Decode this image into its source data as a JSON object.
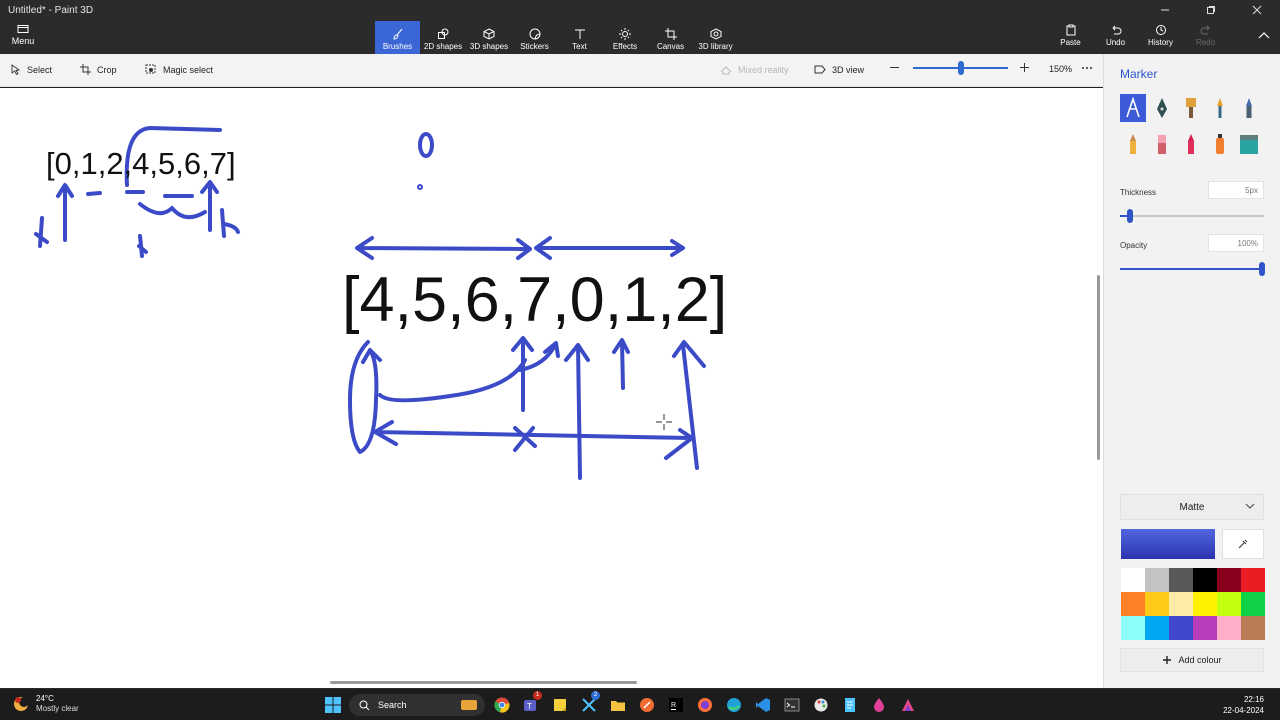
{
  "window": {
    "title": "Untitled* - Paint 3D",
    "controls": [
      "minimize",
      "maximize",
      "close"
    ]
  },
  "ribbon": {
    "menu_label": "Menu",
    "tools": [
      {
        "label": "Brushes",
        "icon": "brush-icon",
        "active": true
      },
      {
        "label": "2D shapes",
        "icon": "2d-shapes-icon",
        "active": false
      },
      {
        "label": "3D shapes",
        "icon": "3d-shapes-icon",
        "active": false
      },
      {
        "label": "Stickers",
        "icon": "stickers-icon",
        "active": false
      },
      {
        "label": "Text",
        "icon": "text-icon",
        "active": false
      },
      {
        "label": "Effects",
        "icon": "effects-icon",
        "active": false
      },
      {
        "label": "Canvas",
        "icon": "canvas-icon",
        "active": false
      },
      {
        "label": "3D library",
        "icon": "3d-library-icon",
        "active": false
      }
    ],
    "actions": [
      {
        "label": "Paste",
        "icon": "paste-icon",
        "enabled": true
      },
      {
        "label": "Undo",
        "icon": "undo-icon",
        "enabled": true
      },
      {
        "label": "History",
        "icon": "history-icon",
        "enabled": true
      },
      {
        "label": "Redo",
        "icon": "redo-icon",
        "enabled": false
      }
    ]
  },
  "subbar": {
    "select_label": "Select",
    "crop_label": "Crop",
    "magic_select_label": "Magic select",
    "mixed_reality_label": "Mixed reality",
    "view_3d_label": "3D view",
    "zoom_value": "150%",
    "zoom_fraction": 0.48
  },
  "canvas": {
    "small_array_text": "[0,1,2,4,5,6,7]",
    "big_array_text": "[4,5,6,7,0,1,2]",
    "ink_color": "#3b4bc8"
  },
  "panel": {
    "title": "Marker",
    "brushes": [
      "marker-icon",
      "calligraphy-pen-icon",
      "oil-brush-icon",
      "watercolor-icon",
      "pixel-pen-icon",
      "pencil-icon",
      "eraser-icon",
      "crayon-icon",
      "spray-can-icon",
      "fill-icon"
    ],
    "thickness_label": "Thickness",
    "thickness_value": "5px",
    "thickness_fraction": 0.05,
    "opacity_label": "Opacity",
    "opacity_value": "100%",
    "opacity_fraction": 1.0,
    "finish_value": "Matte",
    "selected_color": "#3b4bc8",
    "swatches": [
      "#ffffff",
      "#c3c3c3",
      "#585858",
      "#000000",
      "#88001b",
      "#ec1c24",
      "#ff7f27",
      "#ffca18",
      "#fdeca6",
      "#fff200",
      "#c4ff0e",
      "#0ed145",
      "#8cfffb",
      "#00a8f3",
      "#3f48cc",
      "#b83dba",
      "#ffaec8",
      "#b97a56"
    ],
    "add_colour_label": "Add colour"
  },
  "taskbar": {
    "temperature": "24°C",
    "condition": "Mostly clear",
    "search_label": "Search",
    "time": "22:16",
    "date": "22-04-2024",
    "badge_mail": "1",
    "badge_app": "2"
  }
}
